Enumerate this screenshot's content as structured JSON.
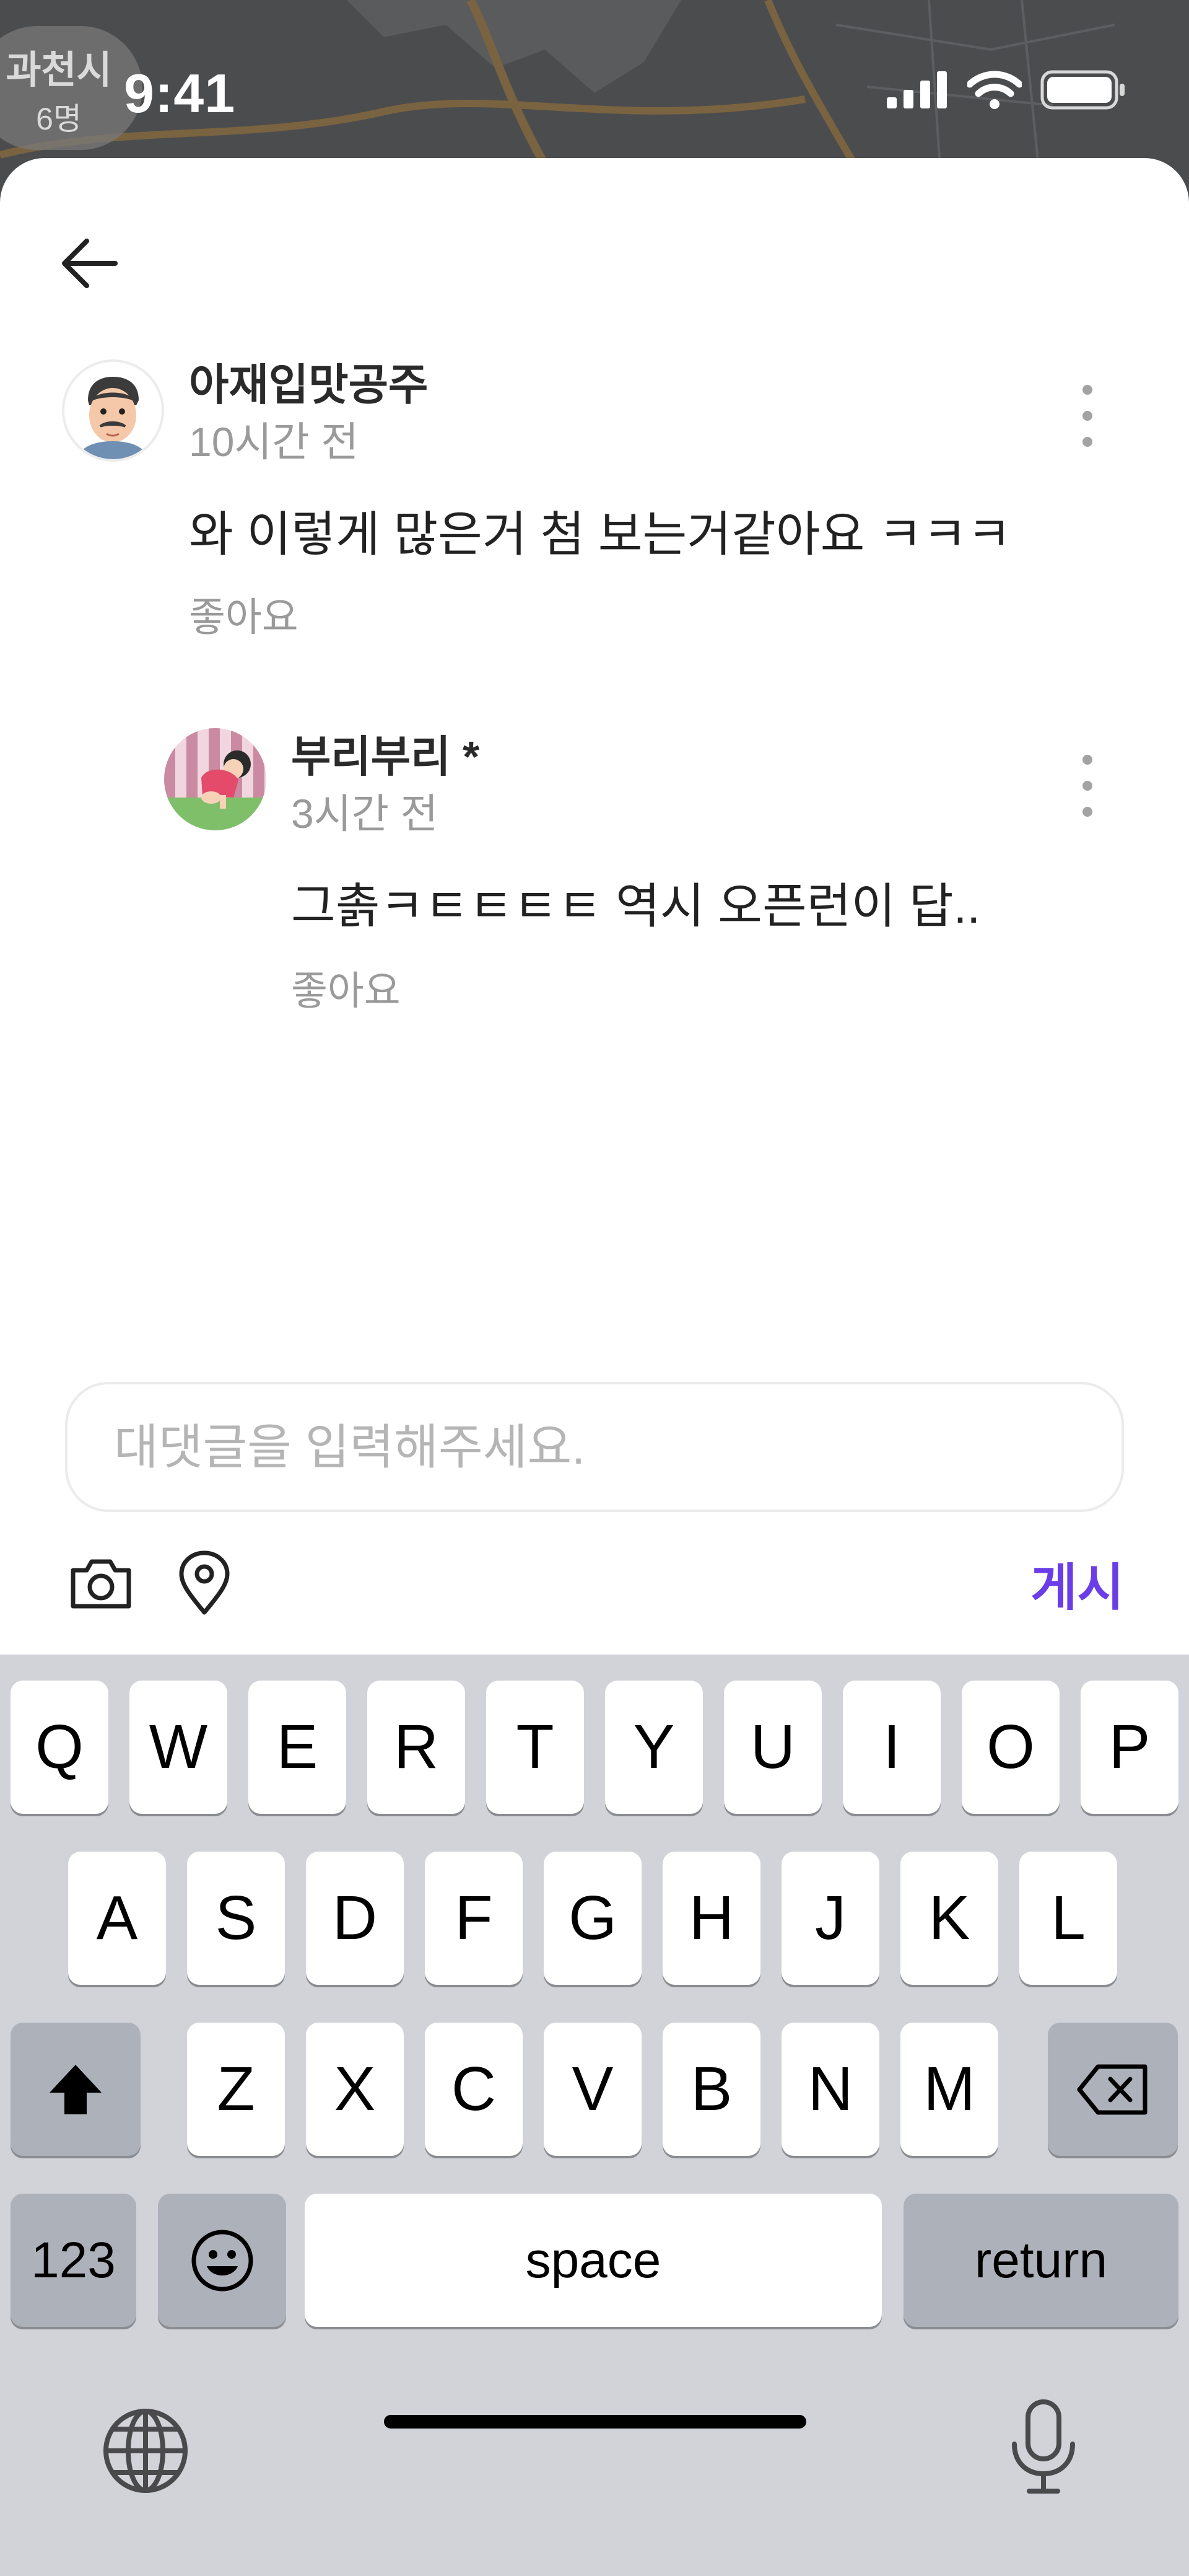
{
  "map": {
    "chip_place": "과천시",
    "chip_count": "6명"
  },
  "status_bar": {
    "time": "9:41"
  },
  "comments": [
    {
      "author": "아재입맛공주",
      "time": "10시간 전",
      "text": "와 이렇게 많은거 첨 보는거같아요 ㅋㅋㅋ",
      "like_label": "좋아요",
      "avatar_icon": "man-face-avatar"
    },
    {
      "author": "부리부리 *",
      "time": "3시간 전",
      "text": "그촑ㅋㅌㅌㅌㅌ 역시 오픈런이 답..",
      "like_label": "좋아요",
      "avatar_icon": "cartoon-character-avatar"
    }
  ],
  "reply": {
    "placeholder": "대댓글을 입력해주세요.",
    "post_label": "게시",
    "accent_color": "#6a3de8"
  },
  "keyboard": {
    "row1": [
      "Q",
      "W",
      "E",
      "R",
      "T",
      "Y",
      "U",
      "I",
      "O",
      "P"
    ],
    "row2": [
      "A",
      "S",
      "D",
      "F",
      "G",
      "H",
      "J",
      "K",
      "L"
    ],
    "row3": [
      "Z",
      "X",
      "C",
      "V",
      "B",
      "N",
      "M"
    ],
    "numbers_label": "123",
    "space_label": "space",
    "return_label": "return"
  }
}
